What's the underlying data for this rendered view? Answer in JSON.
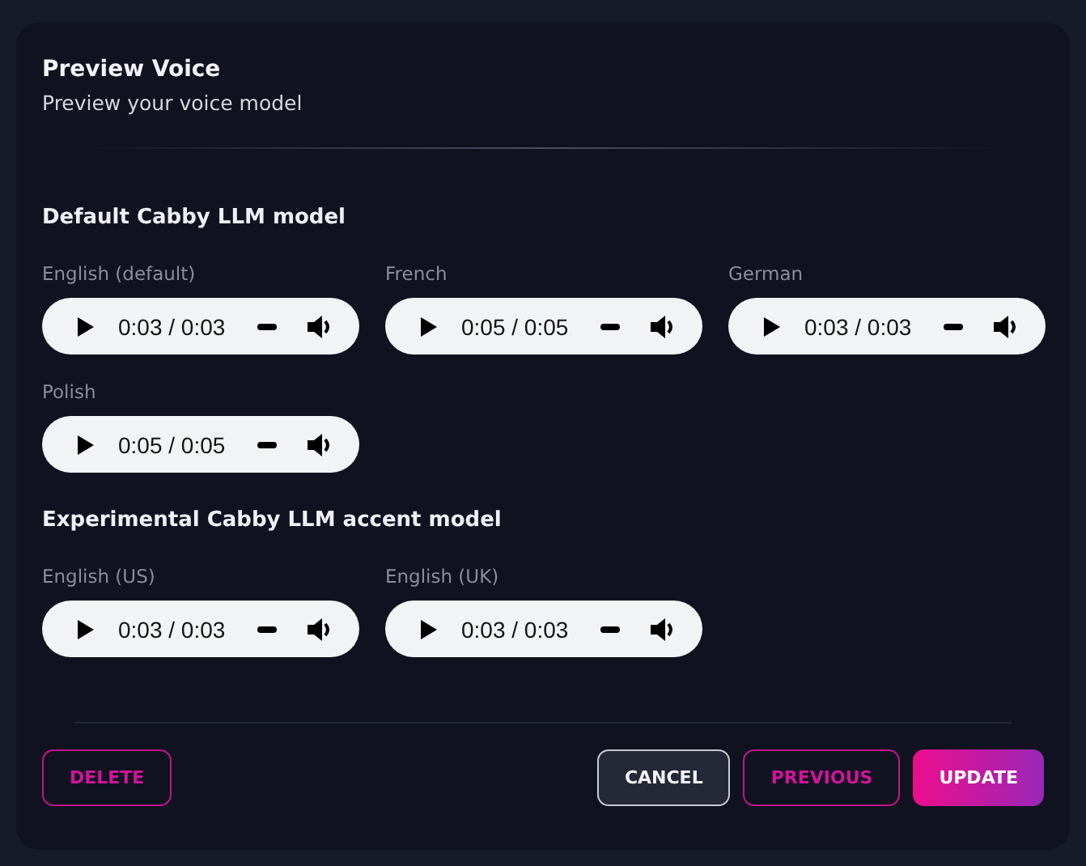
{
  "dialog": {
    "title": "Preview Voice",
    "subtitle": "Preview your voice model"
  },
  "sections": [
    {
      "heading": "Default Cabby LLM model",
      "players": [
        {
          "label": "English (default)",
          "time": "0:03 / 0:03"
        },
        {
          "label": "French",
          "time": "0:05 / 0:05"
        },
        {
          "label": "German",
          "time": "0:03 / 0:03"
        },
        {
          "label": "Polish",
          "time": "0:05 / 0:05"
        }
      ]
    },
    {
      "heading": "Experimental Cabby LLM accent model",
      "players": [
        {
          "label": "English (US)",
          "time": "0:03 / 0:03"
        },
        {
          "label": "English (UK)",
          "time": "0:03 / 0:03"
        }
      ]
    }
  ],
  "buttons_left": [
    {
      "label": "DELETE",
      "kind": "outline"
    }
  ],
  "buttons_right": [
    {
      "label": "CANCEL",
      "kind": "secondary"
    },
    {
      "label": "PREVIOUS",
      "kind": "outline"
    },
    {
      "label": "UPDATE",
      "kind": "primary"
    }
  ]
}
